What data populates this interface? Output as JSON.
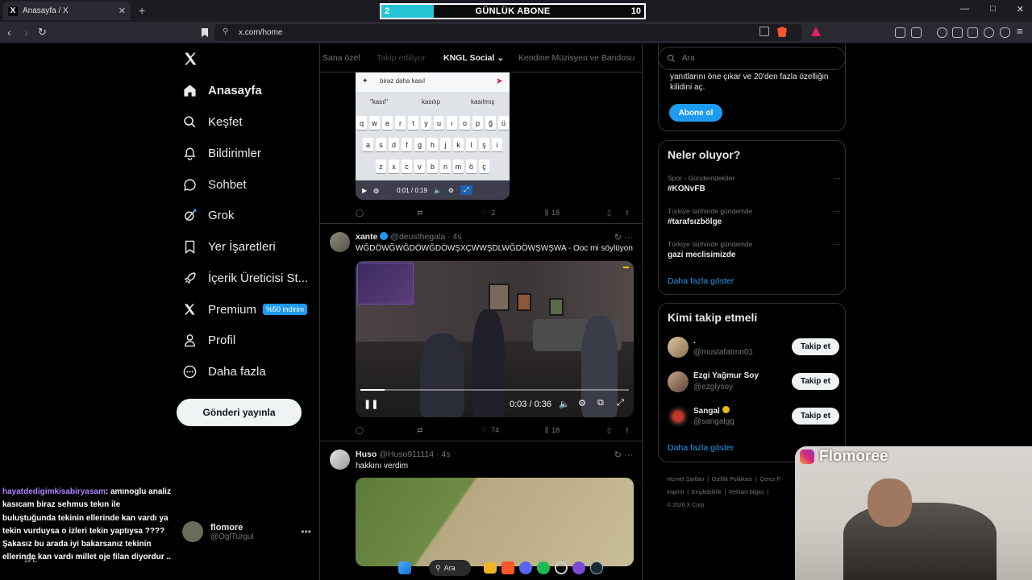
{
  "browser": {
    "tab_title": "Anasayfa / X",
    "tab_favicon": "X",
    "url": "x.com/home",
    "window_controls": [
      "—",
      "□",
      "✕"
    ]
  },
  "stream_overlay": {
    "abone_current": "2",
    "abone_label": "GÜNLÜK ABONE",
    "abone_goal": "10",
    "abone_progress": 0.2,
    "webcam_name": "Flomoree",
    "chat": {
      "user": "hayatdedigimkisabiryasam",
      "message": ": amınoglu analiz kasıcam biraz sehmus tekın ile buluştuğunda tekinin ellerinde kan vardı ya tekin vurduysa o izleri tekin yaptıysa ???? Şakasız bu arada iyi bakarsanız tekinin ellerinde kan vardı millet oje filan diyordur .."
    },
    "weather": "13°C",
    "taskbar_search": "Ara"
  },
  "sidebar": {
    "items": [
      {
        "label": "Anasayfa",
        "icon": "home-icon"
      },
      {
        "label": "Keşfet",
        "icon": "search-icon"
      },
      {
        "label": "Bildirimler",
        "icon": "bell-icon"
      },
      {
        "label": "Sohbet",
        "icon": "chat-icon"
      },
      {
        "label": "Grok",
        "icon": "grok-icon"
      },
      {
        "label": "Yer İşaretleri",
        "icon": "bookmark-icon"
      },
      {
        "label": "İçerik Üreticisi St...",
        "icon": "rocket-icon"
      },
      {
        "label": "Premium",
        "icon": "x-logo-icon"
      },
      {
        "label": "Profil",
        "icon": "person-icon"
      },
      {
        "label": "Daha fazla",
        "icon": "more-circle-icon"
      }
    ],
    "premium_badge": "%50 indirim",
    "post_button": "Gönderi yayınla",
    "profile": {
      "name": "flomore",
      "handle": "@OglTurgul"
    }
  },
  "feed": {
    "tabs": [
      "Sana özel",
      "Takip ediliyor",
      "KNGL Social",
      "Kendine Müzisyen ve Bandosu"
    ],
    "tweet1": {
      "media_search": "biraz daha kasıl",
      "suggestions": [
        "\"kasıl\"",
        "kasılıp",
        "kasılmış"
      ],
      "rows": [
        "qwertyuıopğü",
        "asdfghjklşi",
        "zxcvbnmöç"
      ],
      "video_time": "0:01 / 0:19",
      "replies": "",
      "retweets": "",
      "likes": "2",
      "views": "18"
    },
    "tweet2": {
      "name": "xante",
      "handle": "@deusthegala",
      "time": "· 4s",
      "text": "WĞDÖWĞWĞDÖWĞDÖWŞXÇWWŞDLWĞDÖWŞWŞWA - Ooc mi söylüyon",
      "video_time": "0:03 / 0:36",
      "likes": "74",
      "views": "18"
    },
    "tweet3": {
      "name": "Huso",
      "handle": "@Huso911114",
      "time": "· 4s",
      "text": "hakkını verdim"
    }
  },
  "right": {
    "search_placeholder": "Ara",
    "premium_text": "yanıtlarını öne çıkar ve 20'den fazla özelliğin kilidini aç.",
    "premium_button": "Abone ol",
    "trends_title": "Neler oluyor?",
    "trends": [
      {
        "category": "Spor · Gündemdekiler",
        "title": "#KONvFB"
      },
      {
        "category": "Türkiye tarihinde gündemde",
        "title": "#tarafsızbölge"
      },
      {
        "category": "Türkiye tarihinde gündemde",
        "title": "gazi meclisimizde"
      }
    ],
    "show_more": "Daha fazla göster",
    "follow_title": "Kimi takip etmeli",
    "follow": [
      {
        "name": ".",
        "handle": "@mustafatrnn01",
        "button": "Takip et"
      },
      {
        "name": "Ezgi Yağmur Soy",
        "handle": "@ezglysoy",
        "button": "Takip et"
      },
      {
        "name": "Sangal",
        "handle": "@sangalgg",
        "button": "Takip et"
      }
    ],
    "follow_show_more": "Daha fazla göster",
    "footer_links": [
      "Hizmet Şartları",
      "|",
      "Gizlilik Politikası",
      "|",
      "Çerez P",
      "Imprint",
      "|",
      "Erişilebilirlik",
      "|",
      "Reklam bilgisi",
      "|"
    ],
    "copyright": "© 2026 X Corp."
  }
}
